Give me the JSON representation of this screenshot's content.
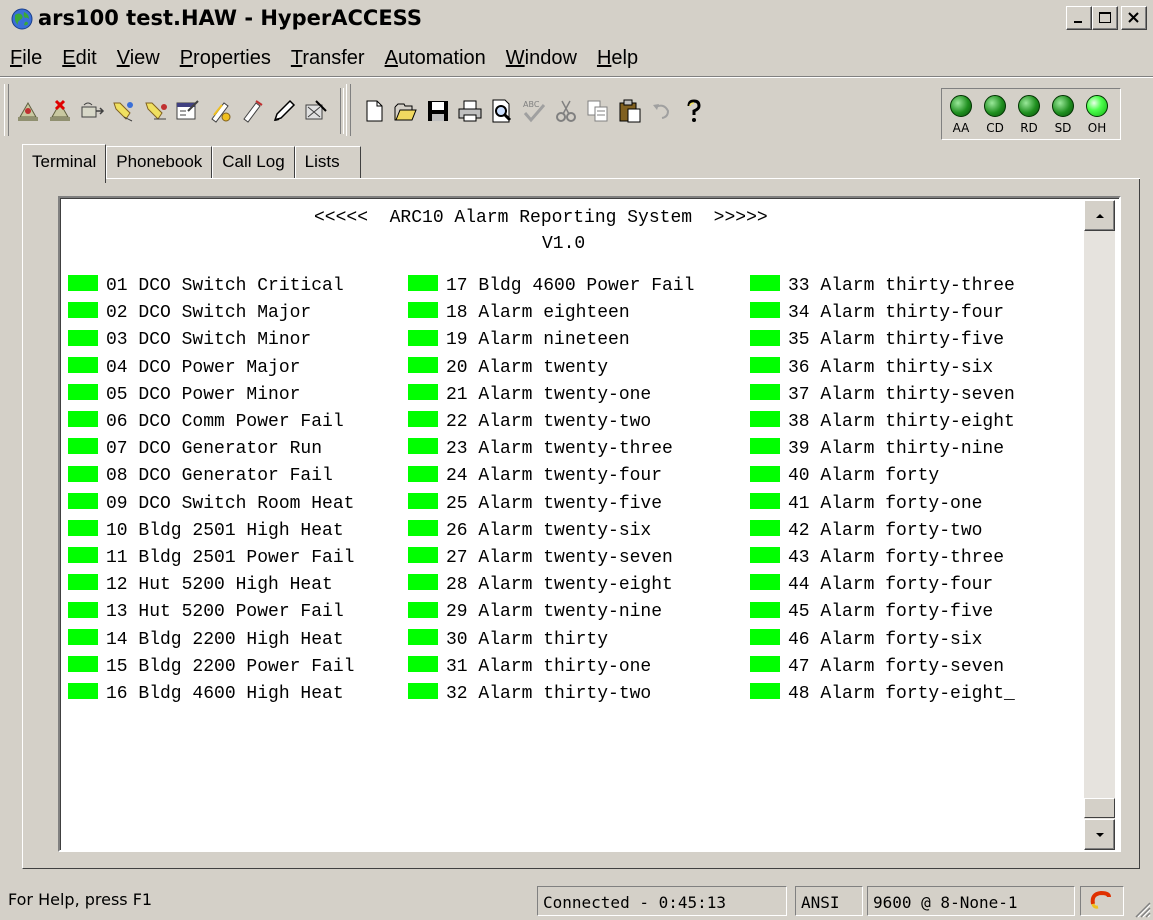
{
  "window": {
    "title": "ars100 test.HAW - HyperACCESS"
  },
  "menu": [
    {
      "label": "File",
      "key": "F",
      "rest": "ile"
    },
    {
      "label": "Edit",
      "key": "E",
      "rest": "dit"
    },
    {
      "label": "View",
      "key": "V",
      "rest": "iew"
    },
    {
      "label": "Properties",
      "key": "P",
      "rest": "roperties"
    },
    {
      "label": "Transfer",
      "key": "T",
      "rest": "ransfer"
    },
    {
      "label": "Automation",
      "key": "A",
      "rest": "utomation"
    },
    {
      "label": "Window",
      "key": "W",
      "rest": "indow"
    },
    {
      "label": "Help",
      "key": "H",
      "rest": "elp"
    }
  ],
  "toolbar": {
    "icons": [
      "connect-icon",
      "disconnect-icon",
      "send-icon",
      "receive-icon",
      "capture-icon",
      "properties-icon",
      "script-icon",
      "learn-icon",
      "edit-icon",
      "tool-icon",
      "new-icon",
      "open-icon",
      "save-icon",
      "print-icon",
      "print-preview-icon",
      "spell-check-icon",
      "cut-icon",
      "copy-icon",
      "paste-icon",
      "undo-icon",
      "help-icon"
    ]
  },
  "leds": [
    {
      "label": "AA",
      "lit": false
    },
    {
      "label": "CD",
      "lit": false
    },
    {
      "label": "RD",
      "lit": false
    },
    {
      "label": "SD",
      "lit": false
    },
    {
      "label": "OH",
      "lit": true
    }
  ],
  "tabs": [
    {
      "label": "Terminal",
      "active": true
    },
    {
      "label": "Phonebook",
      "active": false
    },
    {
      "label": "Call Log",
      "active": false
    },
    {
      "label": "Lists",
      "active": false
    }
  ],
  "terminal": {
    "header_line1": "<<<<<  ARC10 Alarm Reporting System  >>>>>",
    "header_line2": "V1.0",
    "indicator_color": "#00ff00",
    "columns": [
      [
        "01 DCO Switch Critical",
        "02 DCO Switch Major",
        "03 DCO Switch Minor",
        "04 DCO Power Major",
        "05 DCO Power Minor",
        "06 DCO Comm Power Fail",
        "07 DCO Generator Run",
        "08 DCO Generator Fail",
        "09 DCO Switch Room Heat",
        "10 Bldg 2501 High Heat",
        "11 Bldg 2501 Power Fail",
        "12 Hut 5200 High Heat",
        "13 Hut 5200 Power Fail",
        "14 Bldg 2200 High Heat",
        "15 Bldg 2200 Power Fail",
        "16 Bldg 4600 High Heat"
      ],
      [
        "17 Bldg 4600 Power Fail",
        "18 Alarm eighteen",
        "19 Alarm nineteen",
        "20 Alarm twenty",
        "21 Alarm twenty-one",
        "22 Alarm twenty-two",
        "23 Alarm twenty-three",
        "24 Alarm twenty-four",
        "25 Alarm twenty-five",
        "26 Alarm twenty-six",
        "27 Alarm twenty-seven",
        "28 Alarm twenty-eight",
        "29 Alarm twenty-nine",
        "30 Alarm thirty",
        "31 Alarm thirty-one",
        "32 Alarm thirty-two"
      ],
      [
        "33 Alarm thirty-three",
        "34 Alarm thirty-four",
        "35 Alarm thirty-five",
        "36 Alarm thirty-six",
        "37 Alarm thirty-seven",
        "38 Alarm thirty-eight",
        "39 Alarm thirty-nine",
        "40 Alarm forty",
        "41 Alarm forty-one",
        "42 Alarm forty-two",
        "43 Alarm forty-three",
        "44 Alarm forty-four",
        "45 Alarm forty-five",
        "46 Alarm forty-six",
        "47 Alarm forty-seven",
        "48 Alarm forty-eight"
      ]
    ],
    "cursor_char": "_"
  },
  "statusbar": {
    "help": "For Help, press F1",
    "connection": "Connected - 0:45:13",
    "emulation": "ANSI",
    "settings": "9600 @ 8-None-1"
  }
}
